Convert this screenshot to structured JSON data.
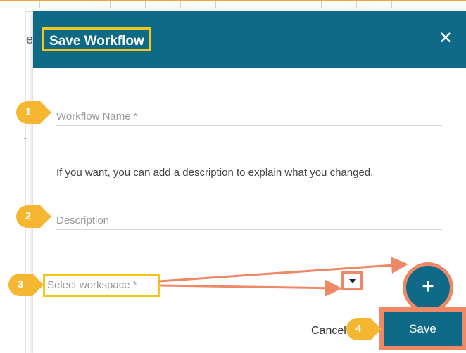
{
  "background": {
    "partial_text": "e"
  },
  "dialog": {
    "title": "Save Workflow",
    "close_label": "✕",
    "workflow_name_placeholder": "Workflow Name *",
    "description_hint": "If you want, you can add a description to explain what you changed.",
    "description_placeholder": "Description",
    "workspace_placeholder": "Select workspace *",
    "add_label": "+",
    "cancel_label": "Cancel",
    "save_label": "Save"
  },
  "callouts": [
    "1",
    "2",
    "3",
    "4"
  ],
  "colors": {
    "header": "#0e6a86",
    "highlight_yellow": "#f5c518",
    "highlight_orange": "#ee8866",
    "badge": "#f5b731"
  },
  "icons": {
    "close": "close-icon",
    "dropdown": "chevron-down-icon",
    "add": "plus-icon"
  }
}
